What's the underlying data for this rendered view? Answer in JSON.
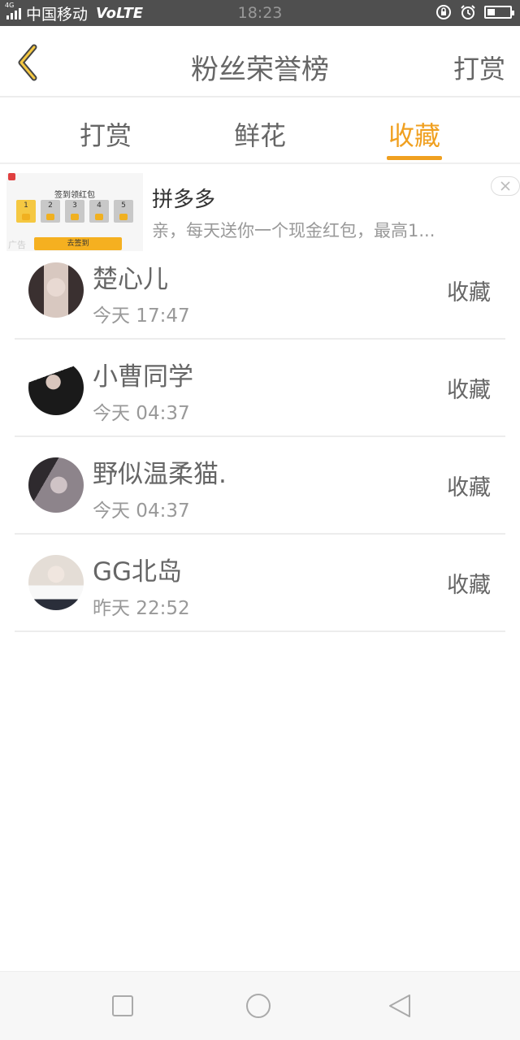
{
  "status_bar": {
    "network_tag": "4G",
    "carrier": "中国移动",
    "volte": "VoLTE",
    "time": "18:23",
    "battery_level": 0.3
  },
  "header": {
    "title": "粉丝荣誉榜",
    "action": "打赏",
    "back_icon": "chevron-left-icon",
    "accent": "#f0a020"
  },
  "tabs": [
    {
      "label": "打赏",
      "active": false
    },
    {
      "label": "鲜花",
      "active": false
    },
    {
      "label": "收藏",
      "active": true
    }
  ],
  "ad": {
    "image_header": "签到领红包",
    "days": [
      "1",
      "2",
      "3",
      "4",
      "5"
    ],
    "image_button": "去签到",
    "image_label": "广告",
    "title": "拼多多",
    "description": "亲，每天送你一个现金红包，最高1..."
  },
  "list": [
    {
      "name": "楚心儿",
      "time": "今天 17:47",
      "action": "收藏"
    },
    {
      "name": "小曹同学",
      "time": "今天 04:37",
      "action": "收藏"
    },
    {
      "name": "野似温柔猫.",
      "time": "今天 04:37",
      "action": "收藏"
    },
    {
      "name": "GG北岛",
      "time": "昨天 22:52",
      "action": "收藏"
    }
  ],
  "nav": {
    "buttons": [
      "square-icon",
      "circle-icon",
      "triangle-back-icon"
    ]
  }
}
